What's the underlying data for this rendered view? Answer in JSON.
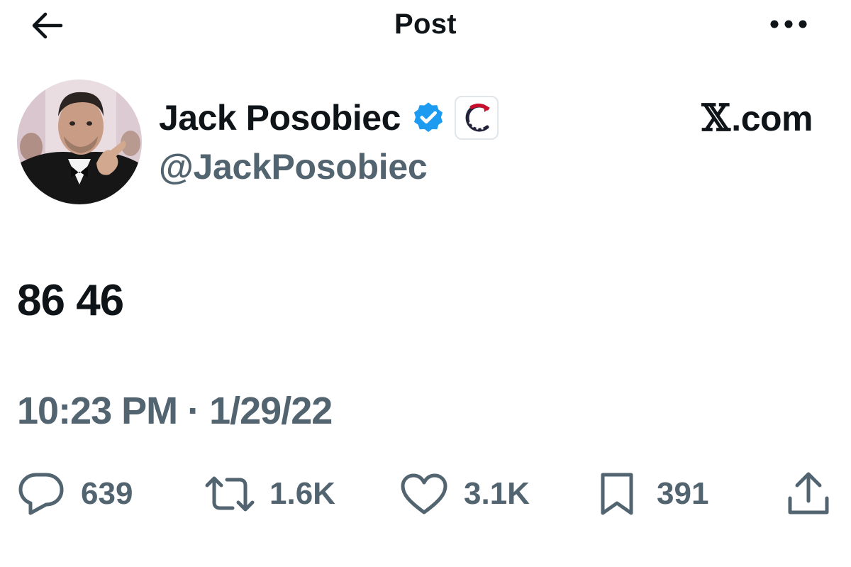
{
  "header": {
    "title": "Post"
  },
  "author": {
    "display_name": "Jack Posobiec",
    "handle": "@JackPosobiec",
    "verified": true,
    "avatar_icon": "profile-photo"
  },
  "source_label": {
    "glyph": "𝕏",
    "text": ".com"
  },
  "post": {
    "text": "86 46",
    "timestamp": "10:23 PM · 1/29/22"
  },
  "engagement": {
    "replies": "639",
    "reposts": "1.6K",
    "likes": "3.1K",
    "bookmarks": "391"
  },
  "colors": {
    "text_primary": "#0f1419",
    "text_secondary": "#536471",
    "verified_blue": "#1d9bf0",
    "background": "#ffffff"
  }
}
